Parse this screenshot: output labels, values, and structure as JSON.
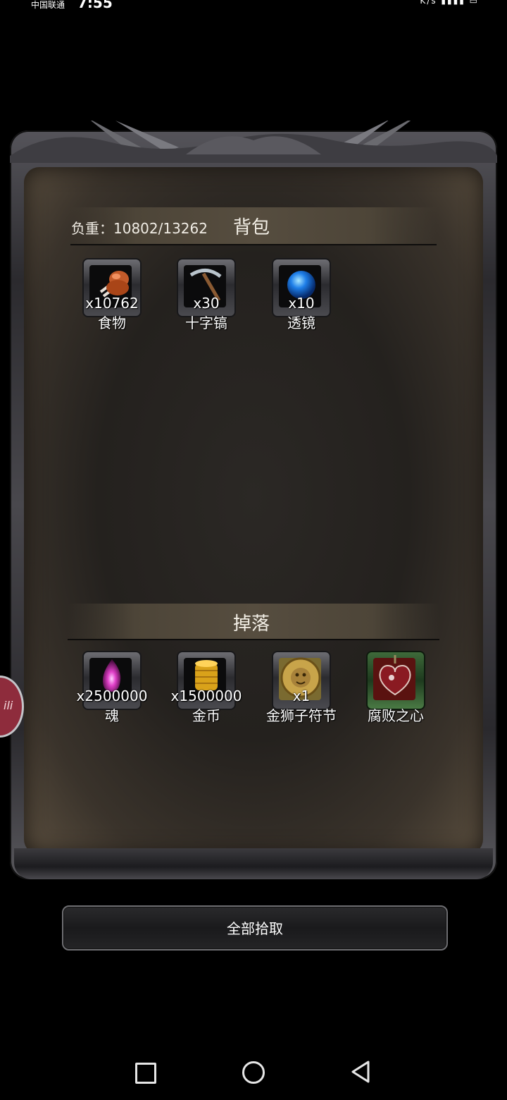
{
  "status_bar": {
    "carrier": "中国联通",
    "time": "7:55",
    "indicators": "K/s"
  },
  "bag": {
    "weight_label": "负重：10802/13262",
    "title": "背包",
    "items": [
      {
        "qty": "x10762",
        "name": "食物",
        "icon": "meat-icon"
      },
      {
        "qty": "x30",
        "name": "十字镐",
        "icon": "pickaxe-icon"
      },
      {
        "qty": "x10",
        "name": "透镜",
        "icon": "lens-orb-icon"
      }
    ]
  },
  "drop": {
    "title": "掉落",
    "items": [
      {
        "qty": "x2500000",
        "name": "魂",
        "icon": "soul-flame-icon"
      },
      {
        "qty": "x1500000",
        "name": "金币",
        "icon": "gold-coins-icon"
      },
      {
        "qty": "x1",
        "name": "金狮子符节",
        "icon": "golden-lion-token-icon"
      },
      {
        "qty": "",
        "name": "腐败之心",
        "icon": "corrupted-heart-icon"
      }
    ]
  },
  "pickup_all_label": "全部拾取",
  "side_bubble_text": "ili",
  "colors": {
    "background": "#000000",
    "parchment": "#24211e",
    "header_band": "#564d3f",
    "side_bubble": "#8e2c3c"
  }
}
